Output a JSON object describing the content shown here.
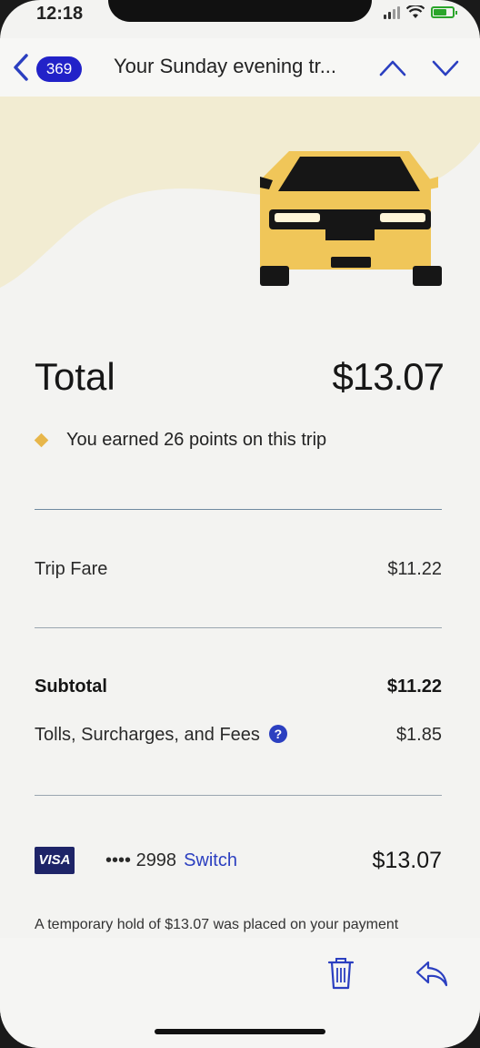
{
  "status_bar": {
    "time": "12:18"
  },
  "navbar": {
    "unread_count": "369",
    "subject": "Your Sunday evening tr..."
  },
  "receipt": {
    "total_label": "Total",
    "total_amount": "$13.07",
    "points_text": "You earned 26 points on this trip",
    "trip_fare_label": "Trip Fare",
    "trip_fare_value": "$11.22",
    "subtotal_label": "Subtotal",
    "subtotal_value": "$11.22",
    "fees_label": "Tolls, Surcharges, and Fees",
    "fees_help": "?",
    "fees_value": "$1.85",
    "card_brand": "VISA",
    "card_digits": "•••• 2998",
    "switch_label": "Switch",
    "payment_amount": "$13.07",
    "hold_text": "A temporary hold of $13.07 was placed on your payment"
  },
  "icons": {
    "back": "chevron-left-icon",
    "prev": "chevron-up-icon",
    "next": "chevron-down-icon",
    "trash": "trash-icon",
    "reply": "reply-icon"
  },
  "colors": {
    "accent": "#2b3fc0",
    "badge": "#2222c8",
    "car_yellow": "#f0c659",
    "hero_bg": "#f2ecd2",
    "points_diamond": "#e7b64a"
  }
}
